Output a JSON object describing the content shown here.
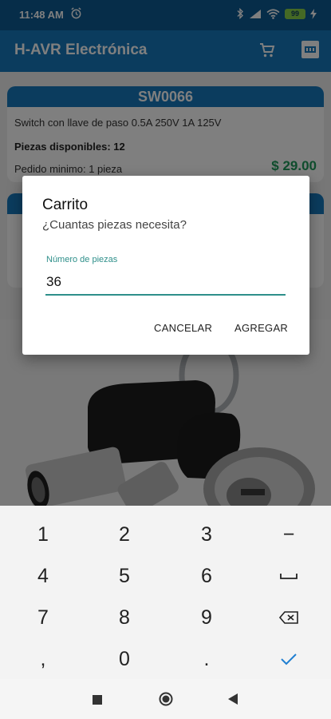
{
  "status_bar": {
    "time": "11:48 AM",
    "battery": "99",
    "icons": [
      "alarm-icon",
      "bluetooth-icon",
      "signal-icon",
      "wifi-icon",
      "battery-icon",
      "charging-icon"
    ]
  },
  "app_bar": {
    "title": "H-AVR Electrónica",
    "icons": [
      "cart-icon",
      "pdf-icon"
    ]
  },
  "product_card": {
    "code": "SW0066",
    "description": "Switch con llave de paso 0.5A 250V 1A 125V",
    "stock": "Piezas disponibles: 12",
    "min_order": "Pedido minimo: 1 pieza",
    "price": "$ 29.00"
  },
  "dialog": {
    "title": "Carrito",
    "message": "¿Cuantas piezas necesita?",
    "field_label": "Número de piezas",
    "field_value": "36",
    "cancel_label": "CANCELAR",
    "add_label": "AGREGAR"
  },
  "keyboard": {
    "keys": [
      "1",
      "2",
      "3",
      "−",
      "4",
      "5",
      "6",
      "␣",
      "7",
      "8",
      "9",
      "⌫",
      ",",
      "0",
      ".",
      "✓"
    ]
  },
  "nav": {
    "icons": [
      "recents-icon",
      "home-icon",
      "back-icon"
    ]
  },
  "colors": {
    "primary": "#1778bd",
    "status_bar": "#0c5a93",
    "accent": "#2e8f8a",
    "price": "#1f9a5a"
  }
}
